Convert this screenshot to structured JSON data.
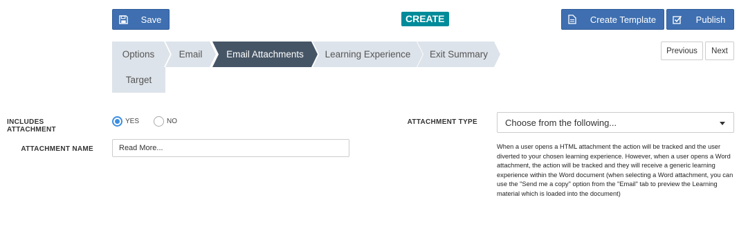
{
  "toolbar": {
    "save_label": "Save",
    "create_badge": "CREATE",
    "create_template_label": "Create Template",
    "publish_label": "Publish"
  },
  "steps": [
    {
      "label": "Options",
      "active": false
    },
    {
      "label": "Email",
      "active": false
    },
    {
      "label": "Email Attachments",
      "active": true
    },
    {
      "label": "Learning Experience",
      "active": false
    },
    {
      "label": "Exit Summary",
      "active": false
    },
    {
      "label": "Target",
      "active": false
    }
  ],
  "pager": {
    "previous_label": "Previous",
    "next_label": "Next"
  },
  "form": {
    "includes_attachment_label": "INCLUDES ATTACHMENT",
    "yes_label": "YES",
    "no_label": "NO",
    "includes_attachment_value": "YES",
    "attachment_name_label": "ATTACHMENT NAME",
    "attachment_name_value": "Read More...",
    "attachment_type_label": "ATTACHMENT TYPE",
    "attachment_type_value": "Choose from the following...",
    "help_text": "When a user opens a HTML attachment the action will be tracked and the user diverted to your chosen learning experience. However, when a user opens a Word attachment, the action will be tracked and they will receive a generic learning experience within the Word document (when selecting a Word attachment, you can use the \"Send me a copy\" option from the \"Email\" tab to preview the Learning material which is loaded into the document)"
  },
  "colors": {
    "primary": "#3f6fb0",
    "badge": "#008b9a",
    "active_step": "#465566",
    "inactive_step": "#dde3ea",
    "radio_accent": "#3d8ee0"
  },
  "icons": {
    "save": "floppy-disk-icon",
    "create_template": "document-icon",
    "publish": "checkbox-check-icon",
    "select_caret": "caret-down-icon"
  }
}
